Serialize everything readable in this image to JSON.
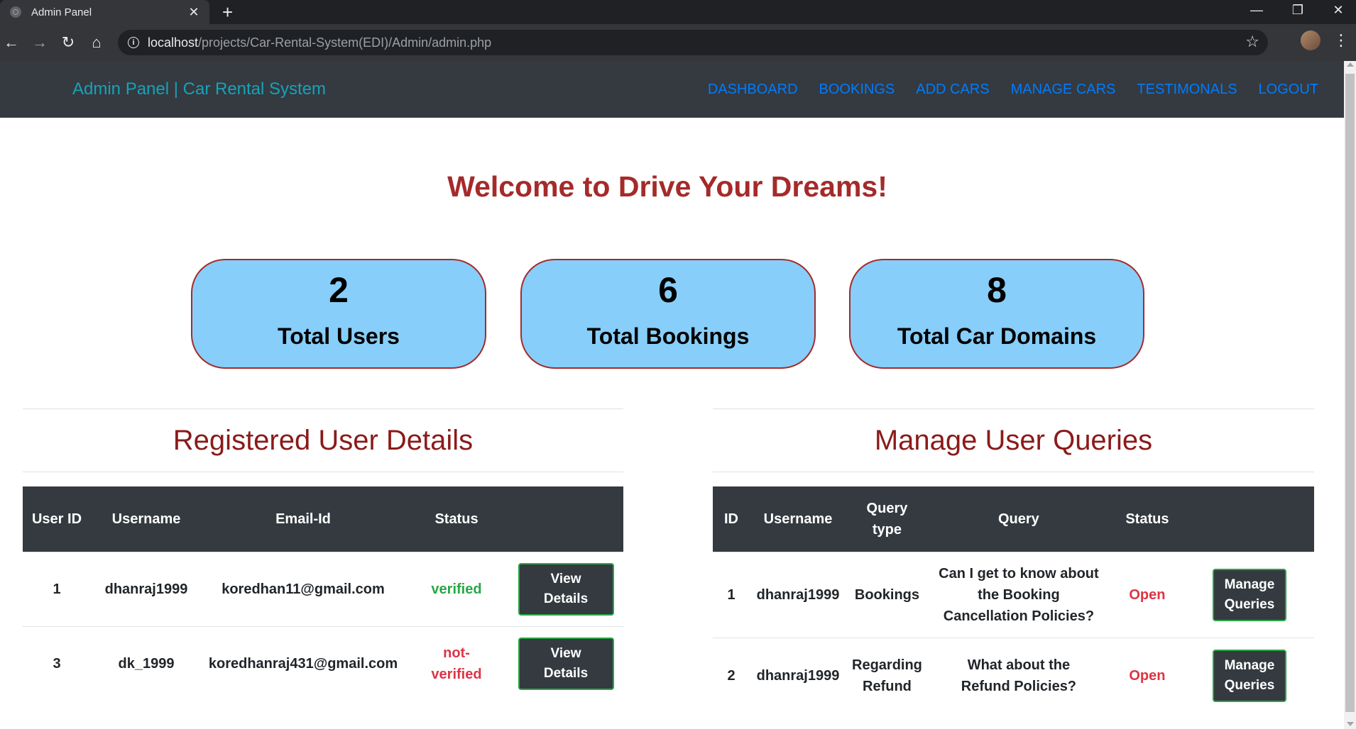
{
  "browser": {
    "tab_title": "Admin Panel",
    "url_host": "localhost",
    "url_path": "/projects/Car-Rental-System(EDI)/Admin/admin.php"
  },
  "navbar": {
    "brand": "Admin Panel | Car Rental System",
    "links": [
      "DASHBOARD",
      "BOOKINGS",
      "ADD CARS",
      "MANAGE CARS",
      "TESTIMONALS",
      "LOGOUT"
    ]
  },
  "welcome": "Welcome to Drive Your Dreams!",
  "stats": [
    {
      "value": "2",
      "label": "Total Users"
    },
    {
      "value": "6",
      "label": "Total Bookings"
    },
    {
      "value": "8",
      "label": "Total Car Domains"
    }
  ],
  "users": {
    "title": "Registered User Details",
    "headers": [
      "User ID",
      "Username",
      "Email-Id",
      "Status",
      ""
    ],
    "rows": [
      {
        "id": "1",
        "username": "dhanraj1999",
        "email": "koredhan11@gmail.com",
        "status": "verified",
        "action": "View Details"
      },
      {
        "id": "3",
        "username": "dk_1999",
        "email": "koredhanraj431@gmail.com",
        "status": "not-verified",
        "action": "View Details"
      }
    ]
  },
  "queries": {
    "title": "Manage User Queries",
    "headers": [
      "ID",
      "Username",
      "Query type",
      "Query",
      "Status",
      ""
    ],
    "rows": [
      {
        "id": "1",
        "username": "dhanraj1999",
        "type": "Bookings",
        "query": "Can I get to know about the Booking Cancellation Policies?",
        "status": "Open",
        "action": "Manage Queries"
      },
      {
        "id": "2",
        "username": "dhanraj1999",
        "type": "Regarding Refund",
        "query": "What about the Refund Policies?",
        "status": "Open",
        "action": "Manage Queries"
      }
    ]
  },
  "colors": {
    "navbar_bg": "#343a40",
    "brand": "#17a2b8",
    "nav_link": "#007bff",
    "heading": "#a52a2a",
    "card_bg": "#87cefa",
    "verified": "#28a745",
    "not_verified": "#dc3545"
  },
  "icons": [
    "globe-icon",
    "close-icon",
    "plus-icon",
    "minimize-icon",
    "restore-icon",
    "back-arrow-icon",
    "forward-arrow-icon",
    "reload-icon",
    "home-icon",
    "info-icon",
    "star-icon",
    "kebab-menu-icon"
  ]
}
